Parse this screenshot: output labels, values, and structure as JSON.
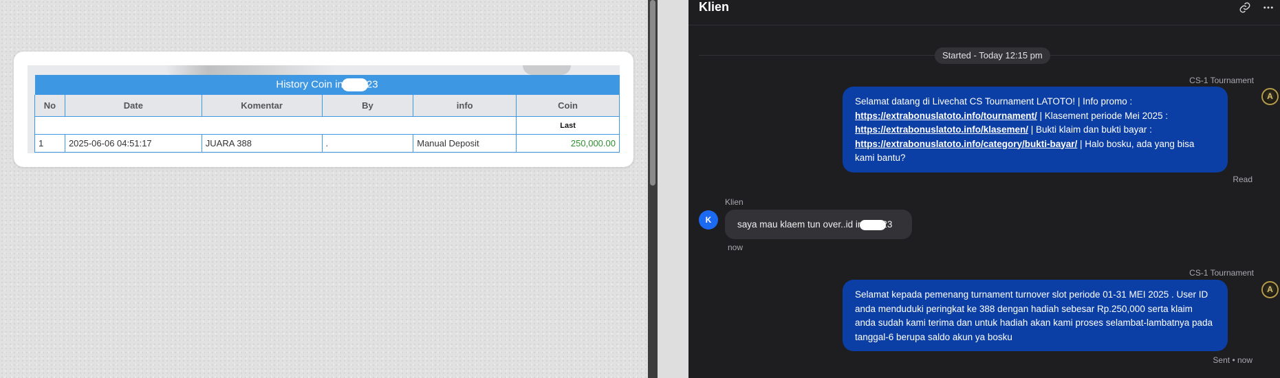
{
  "history": {
    "title_prefix": "History Coin in",
    "title_suffix": "23",
    "columns": [
      "No",
      "Date",
      "Komentar",
      "By",
      "info",
      "Coin"
    ],
    "last_label": "Last",
    "rows": [
      {
        "no": "1",
        "date": "2025-06-06 04:51:17",
        "komentar": "JUARA 388",
        "by": ".",
        "info": "Manual Deposit",
        "coin": "250,000.00"
      }
    ]
  },
  "chat": {
    "title": "Klien",
    "started": "Started - Today 12:15 pm",
    "agent_name": "CS-1 Tournament",
    "agent_avatar_letter": "A",
    "messages": {
      "welcome": {
        "t1": "Selamat datang di Livechat CS Tournament LATOTO! | Info promo :",
        "link1": "https://extrabonuslatoto.info/tournament/",
        "t2": " | Klasement periode Mei 2025 :",
        "link2": "https://extrabonuslatoto.info/klasemen/",
        "t3": " | Bukti klaim dan bukti bayar :",
        "link3": "https://extrabonuslatoto.info/category/bukti-bayar/",
        "t4": " | Halo bosku, ada yang bisa kami bantu?",
        "status": "Read"
      },
      "client": {
        "name": "Klien",
        "avatar_letter": "K",
        "text_prefix": "saya mau klaem tun over..id in",
        "text_suffix": "23",
        "time": "now"
      },
      "reply": {
        "text": "Selamat kepada pemenang turnament turnover slot periode 01-31 MEI 2025 . User ID anda menduduki peringkat ke 388 dengan hadiah sebesar Rp.250,000 serta klaim anda sudah kami terima dan untuk hadiah akan kami proses selambat-lambatnya pada tanggal-6 berupa saldo akun ya bosku",
        "status": "Sent • now"
      }
    },
    "icons": [
      "link-icon",
      "more-icon"
    ]
  }
}
